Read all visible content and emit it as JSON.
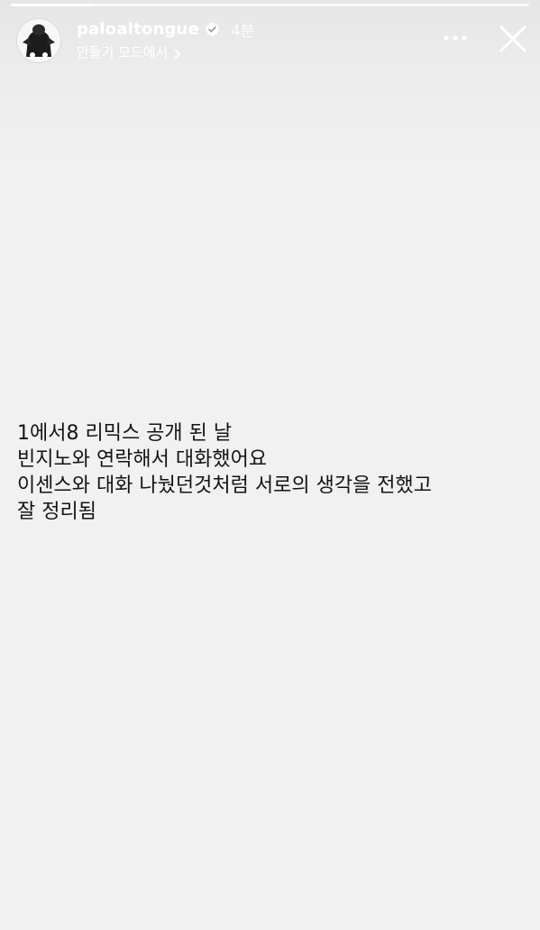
{
  "progress": {
    "fraction": 0.16
  },
  "header": {
    "username": "paloaltongue",
    "timestamp": "4분",
    "made_with": "만들기 모드에서",
    "avatar_icon": "avatar-icon",
    "verified_icon": "verified-badge-icon",
    "more_icon": "more-horizontal-icon",
    "close_icon": "close-icon"
  },
  "story": {
    "lines": [
      "1에서8 리믹스 공개 된 날",
      "빈지노와 연락해서 대화했어요",
      "이센스와 대화 나눴던것처럼 서로의 생각을 전했고",
      "잘 정리됨"
    ]
  },
  "colors": {
    "background": "#f1f1f1",
    "text": "#141414",
    "header_text": "#ffffff",
    "verified": "#3897f0"
  }
}
